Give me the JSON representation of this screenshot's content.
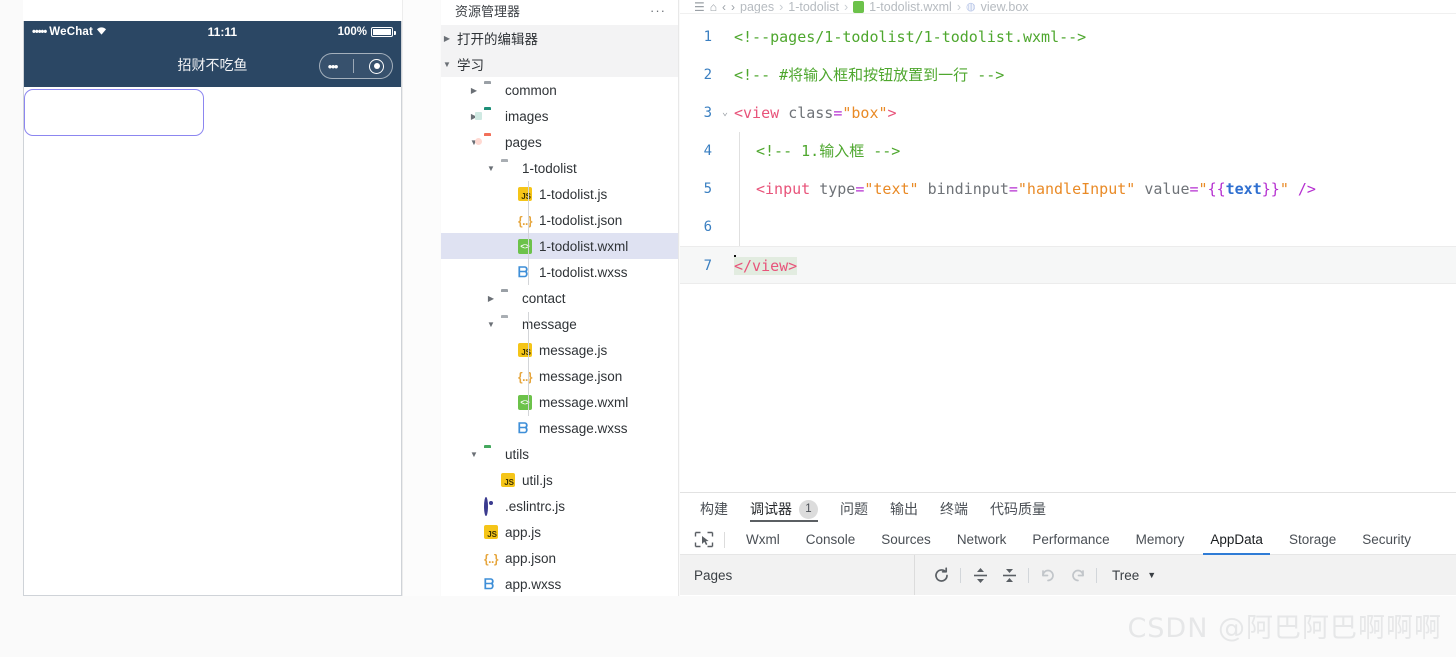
{
  "simulator": {
    "status_bar": {
      "carrier": "WeChat",
      "signal_dots": "•••••",
      "wifi": "⌃",
      "time": "11:11",
      "battery_percent": "100%"
    },
    "nav_title": "招财不吃鱼",
    "capsule": {
      "menu_dots": "•••",
      "close_icon": "target-icon"
    },
    "input_value": ""
  },
  "explorer": {
    "title": "资源管理器",
    "more_label": "···",
    "sections": [
      {
        "label": "打开的编辑器",
        "expanded": false
      },
      {
        "label": "学习",
        "expanded": true
      }
    ],
    "tree": [
      {
        "label": "common",
        "depth": 1,
        "type": "folder",
        "icon": "folder-grey",
        "arrow": "collapsed"
      },
      {
        "label": "images",
        "depth": 1,
        "type": "folder",
        "icon": "folder-images",
        "arrow": "collapsed"
      },
      {
        "label": "pages",
        "depth": 1,
        "type": "folder",
        "icon": "folder-pages",
        "arrow": "expanded"
      },
      {
        "label": "1-todolist",
        "depth": 2,
        "type": "folder",
        "icon": "folder-open-grey",
        "arrow": "expanded"
      },
      {
        "label": "1-todolist.js",
        "depth": 3,
        "type": "file",
        "icon": "js-icon",
        "arrow": "none"
      },
      {
        "label": "1-todolist.json",
        "depth": 3,
        "type": "file",
        "icon": "json-icon",
        "arrow": "none"
      },
      {
        "label": "1-todolist.wxml",
        "depth": 3,
        "type": "file",
        "icon": "wxml-icon",
        "arrow": "none",
        "selected": true
      },
      {
        "label": "1-todolist.wxss",
        "depth": 3,
        "type": "file",
        "icon": "wxss-icon",
        "arrow": "none"
      },
      {
        "label": "contact",
        "depth": 2,
        "type": "folder",
        "icon": "folder-grey",
        "arrow": "collapsed"
      },
      {
        "label": "message",
        "depth": 2,
        "type": "folder",
        "icon": "folder-open-grey",
        "arrow": "expanded"
      },
      {
        "label": "message.js",
        "depth": 3,
        "type": "file",
        "icon": "js-icon",
        "arrow": "none"
      },
      {
        "label": "message.json",
        "depth": 3,
        "type": "file",
        "icon": "json-icon",
        "arrow": "none"
      },
      {
        "label": "message.wxml",
        "depth": 3,
        "type": "file",
        "icon": "wxml-icon",
        "arrow": "none"
      },
      {
        "label": "message.wxss",
        "depth": 3,
        "type": "file",
        "icon": "wxss-icon",
        "arrow": "none"
      },
      {
        "label": "utils",
        "depth": 1,
        "type": "folder",
        "icon": "folder-utils",
        "arrow": "expanded"
      },
      {
        "label": "util.js",
        "depth": 2,
        "type": "file",
        "icon": "js-icon",
        "arrow": "none"
      },
      {
        "label": ".eslintrc.js",
        "depth": 1,
        "type": "file",
        "icon": "eslint-icon",
        "arrow": "none"
      },
      {
        "label": "app.js",
        "depth": 1,
        "type": "file",
        "icon": "js-icon",
        "arrow": "none"
      },
      {
        "label": "app.json",
        "depth": 1,
        "type": "file",
        "icon": "json-icon",
        "arrow": "none"
      },
      {
        "label": "app.wxss",
        "depth": 1,
        "type": "file",
        "icon": "wxss-icon",
        "arrow": "none"
      }
    ]
  },
  "editor": {
    "breadcrumb": [
      "pages",
      "1-todolist",
      "1-todolist.wxml",
      "view.box"
    ],
    "lines": [
      {
        "num": "1",
        "fold": ""
      },
      {
        "num": "2",
        "fold": ""
      },
      {
        "num": "3",
        "fold": "⌄"
      },
      {
        "num": "4",
        "fold": ""
      },
      {
        "num": "5",
        "fold": ""
      },
      {
        "num": "6",
        "fold": ""
      },
      {
        "num": "7",
        "fold": ""
      }
    ],
    "code": {
      "l1": "<!--pages/1-todolist/1-todolist.wxml-->",
      "l2": "<!-- #将输入框和按钮放置到一行 -->",
      "l3_open": "<view ",
      "l3_attr": "class",
      "l3_eq": "=",
      "l3_val": "\"box\"",
      "l3_close": ">",
      "l4": "<!-- 1.输入框 -->",
      "l5_tag": "<input ",
      "l5_attr1": "type",
      "l5_val1": "\"text\"",
      "l5_attr2": "bindinput",
      "l5_val2": "\"handleInput\"",
      "l5_attr3": "value",
      "l5_val3_q1": "\"",
      "l5_val3_mo": "{{",
      "l5_val3_var": "text",
      "l5_val3_mc": "}}",
      "l5_val3_q2": "\"",
      "l5_selfclose": "/>",
      "l7": "</view>"
    }
  },
  "debugger": {
    "panel_tabs": [
      {
        "label": "构建",
        "active": false,
        "badge": ""
      },
      {
        "label": "调试器",
        "active": true,
        "badge": "1"
      },
      {
        "label": "问题",
        "active": false,
        "badge": ""
      },
      {
        "label": "输出",
        "active": false,
        "badge": ""
      },
      {
        "label": "终端",
        "active": false,
        "badge": ""
      },
      {
        "label": "代码质量",
        "active": false,
        "badge": ""
      }
    ],
    "devtools_tabs": [
      {
        "label": "Wxml",
        "active": false
      },
      {
        "label": "Console",
        "active": false
      },
      {
        "label": "Sources",
        "active": false
      },
      {
        "label": "Network",
        "active": false
      },
      {
        "label": "Performance",
        "active": false
      },
      {
        "label": "Memory",
        "active": false
      },
      {
        "label": "AppData",
        "active": true
      },
      {
        "label": "Storage",
        "active": false
      },
      {
        "label": "Security",
        "active": false
      }
    ],
    "appdata": {
      "pages_label": "Pages",
      "refresh_icon": "refresh-icon",
      "expand_icon": "expand-all-icon",
      "collapse_icon": "collapse-all-icon",
      "undo_icon": "undo-icon",
      "redo_icon": "redo-icon",
      "view_mode": "Tree",
      "caret": "▼"
    }
  },
  "watermark": "CSDN @阿巴阿巴啊啊啊"
}
